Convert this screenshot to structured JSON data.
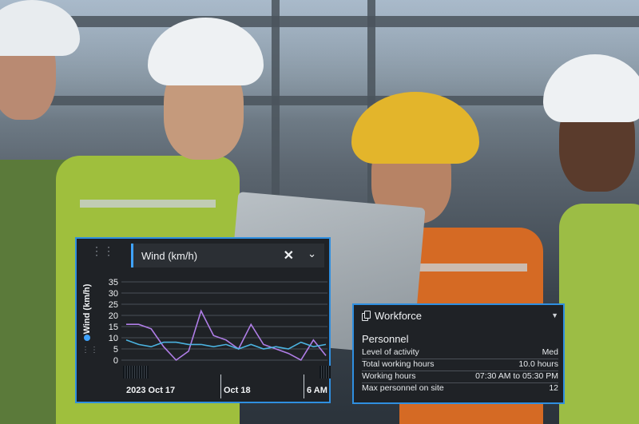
{
  "wind_widget": {
    "series_label": "Wind (km/h)",
    "clear_glyph": "✕",
    "chevron_glyph": "⌄",
    "y_axis_label": "Wind (km/h)",
    "y_ticks": [
      "35",
      "30",
      "25",
      "20",
      "15",
      "10",
      "5",
      "0"
    ],
    "x_ticks": [
      "2023 Oct 17",
      "Oct 18",
      "6 AM"
    ],
    "accent_color": "#2f8fe0",
    "icons": [
      "drag-handle-icon",
      "close-icon",
      "chevron-down-icon",
      "legend-dot-icon"
    ]
  },
  "chart_data": {
    "type": "line",
    "x": [
      "t1",
      "t2",
      "t3",
      "t4",
      "t5",
      "t6",
      "t7",
      "t8",
      "t9",
      "t10",
      "t11",
      "t12",
      "t13",
      "t14",
      "t15",
      "t16",
      "t17"
    ],
    "ylim": [
      0,
      35
    ],
    "ylabel": "Wind (km/h)",
    "grid": true,
    "series": [
      {
        "color": "#b07ee8",
        "values": [
          16,
          16,
          14,
          6,
          0,
          4,
          22,
          11,
          9,
          5,
          16,
          7,
          5,
          3,
          0,
          9,
          2
        ]
      },
      {
        "color": "#4bb3e0",
        "values": [
          9,
          7,
          6,
          8,
          8,
          7,
          7,
          6,
          7,
          5,
          7,
          5,
          6,
          5,
          8,
          6,
          7
        ]
      }
    ]
  },
  "workforce": {
    "title": "Workforce",
    "toggle_glyph": "▼",
    "section": "Personnel",
    "rows": [
      {
        "label": "Level of activity",
        "value": "Med"
      },
      {
        "label": "Total working hours",
        "value": "10.0 hours"
      },
      {
        "label": "Working hours",
        "value": "07:30 AM to 05:30 PM"
      },
      {
        "label": "Max personnel on site",
        "value": "12"
      }
    ],
    "accent_color": "#2f8fe0"
  }
}
